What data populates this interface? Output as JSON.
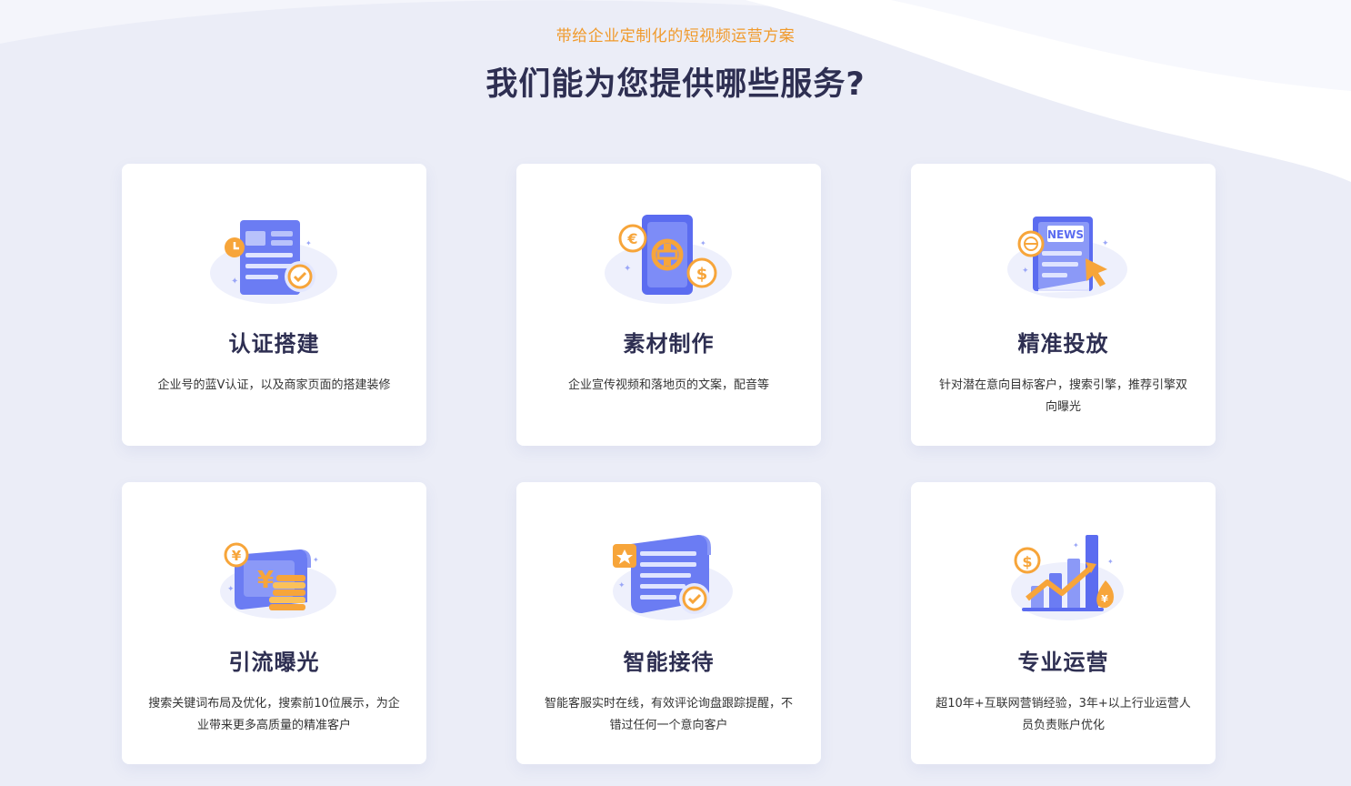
{
  "header": {
    "subtitle": "带给企业定制化的短视频运营方案",
    "title": "我们能为您提供哪些服务?"
  },
  "colors": {
    "background": "#ebedf7",
    "accent_orange": "#f09a2c",
    "title_dark": "#2e2f52",
    "icon_blue": "#5b6cf0",
    "card": "#ffffff"
  },
  "services": [
    {
      "title": "认证搭建",
      "desc": "企业号的蓝V认证，以及商家页面的搭建装修",
      "icon": "certificate-icon"
    },
    {
      "title": "素材制作",
      "desc": "企业宣传视频和落地页的文案，配音等",
      "icon": "currency-card-icon"
    },
    {
      "title": "精准投放",
      "desc": "针对潜在意向目标客户，搜索引擎，推荐引擎双向曝光",
      "icon": "news-target-icon",
      "icon_text": "NEWS"
    },
    {
      "title": "引流曝光",
      "desc": "搜索关键词布局及优化，搜索前10位展示，为企业带来更多高质量的精准客户",
      "icon": "money-coins-icon"
    },
    {
      "title": "智能接待",
      "desc": "智能客服实时在线，有效评论询盘跟踪提醒，不错过任何一个意向客户",
      "icon": "scroll-check-icon"
    },
    {
      "title": "专业运营",
      "desc": "超10年+互联网营销经验，3年+以上行业运营人员负责账户优化",
      "icon": "growth-chart-icon"
    }
  ]
}
